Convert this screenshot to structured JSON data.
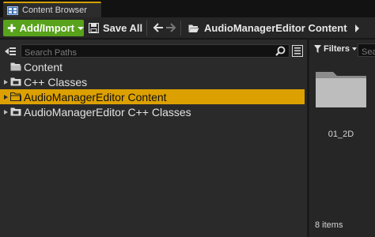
{
  "tab": {
    "title": "Content Browser",
    "icon": "content-browser-icon"
  },
  "toolbar": {
    "add_import_label": "Add/Import",
    "save_all_label": "Save All",
    "breadcrumb_label": "AudioManagerEditor Content",
    "add_button_color": "#58a21c"
  },
  "sources": {
    "search_placeholder": "Search Paths",
    "tree": [
      {
        "label": "Content",
        "level": 0,
        "expandable": false,
        "icon": "folder-open-icon",
        "selected": false
      },
      {
        "label": "C++ Classes",
        "level": 1,
        "expandable": true,
        "icon": "class-folder-icon",
        "selected": false
      },
      {
        "label": "AudioManagerEditor Content",
        "level": 0,
        "expandable": true,
        "icon": "folder-open-icon",
        "selected": true
      },
      {
        "label": "AudioManagerEditor C++ Classes",
        "level": 0,
        "expandable": true,
        "icon": "class-folder-icon",
        "selected": false
      }
    ],
    "selection_color": "#dca000"
  },
  "assets": {
    "filters_label": "Filters",
    "search_placeholder": "Search",
    "items": [
      {
        "label": "01_2D",
        "icon": "folder-icon"
      }
    ],
    "item_count": "8 items"
  }
}
